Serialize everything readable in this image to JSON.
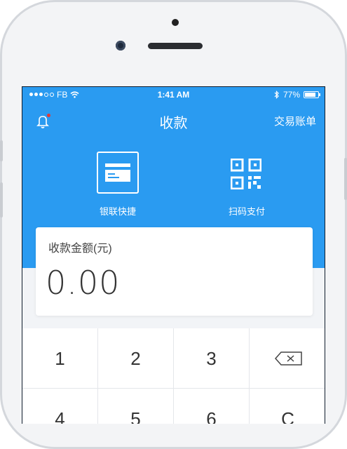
{
  "status_bar": {
    "carrier": "FB",
    "time": "1:41 AM",
    "battery": "77%"
  },
  "nav": {
    "title": "收款",
    "right_link": "交易账单"
  },
  "actions": [
    {
      "label": "银联快捷",
      "icon": "card-icon"
    },
    {
      "label": "扫码支付",
      "icon": "qr-code-icon"
    }
  ],
  "amount": {
    "label": "收款金额(元)",
    "value": "0.00"
  },
  "keypad": {
    "row1": [
      "1",
      "2",
      "3"
    ],
    "row2": [
      "4",
      "5",
      "6",
      "C"
    ],
    "delete_icon": "backspace-icon"
  },
  "colors": {
    "primary": "#2a9bf1",
    "notification_dot": "#e53935"
  }
}
